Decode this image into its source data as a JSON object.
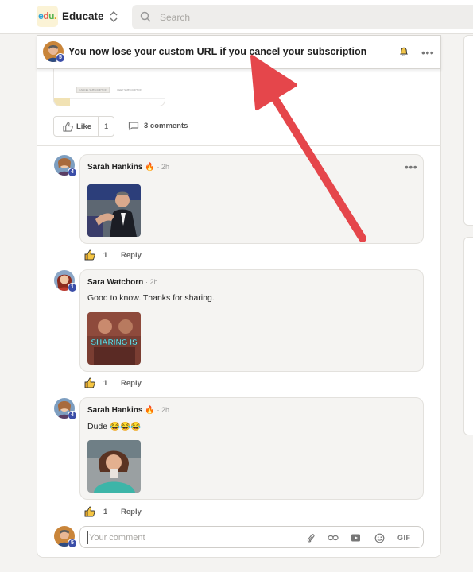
{
  "topbar": {
    "logo": {
      "e": "e",
      "d": "d",
      "u": "u",
      "dot": "."
    },
    "app_name": "Educate",
    "search_placeholder": "Search"
  },
  "sticky_header": {
    "title": "You now lose your custom URL if you cancel your subscription",
    "author_badge": "5"
  },
  "post": {
    "thumb_buttons": [
      "CANCEL SUBSCRIPTION",
      "KEEP SUBSCRIPTION"
    ],
    "like_label": "Like",
    "like_count": "1",
    "comments_label": "3 comments"
  },
  "comments": [
    {
      "author": "Sarah Hankins",
      "emoji": "🔥",
      "time": "· 2h",
      "badge": "4",
      "text": "",
      "gif_text": "",
      "likes": "1",
      "reply_label": "Reply"
    },
    {
      "author": "Sara Watchorn",
      "emoji": "",
      "time": "· 2h",
      "badge": "1",
      "text": "Good to know. Thanks for sharing.",
      "gif_text": "SHARING IS",
      "likes": "1",
      "reply_label": "Reply"
    },
    {
      "author": "Sarah Hankins",
      "emoji": "🔥",
      "time": "· 2h",
      "badge": "4",
      "text": "Dude 😂😂😂",
      "gif_text": "",
      "likes": "1",
      "reply_label": "Reply"
    }
  ],
  "composer": {
    "placeholder": "Your comment",
    "gif_label": "GIF",
    "user_badge": "5"
  },
  "colors": {
    "annotation_arrow": "#e5464b",
    "badge": "#3b4ea8",
    "like_thumb": "#e0a12a"
  }
}
